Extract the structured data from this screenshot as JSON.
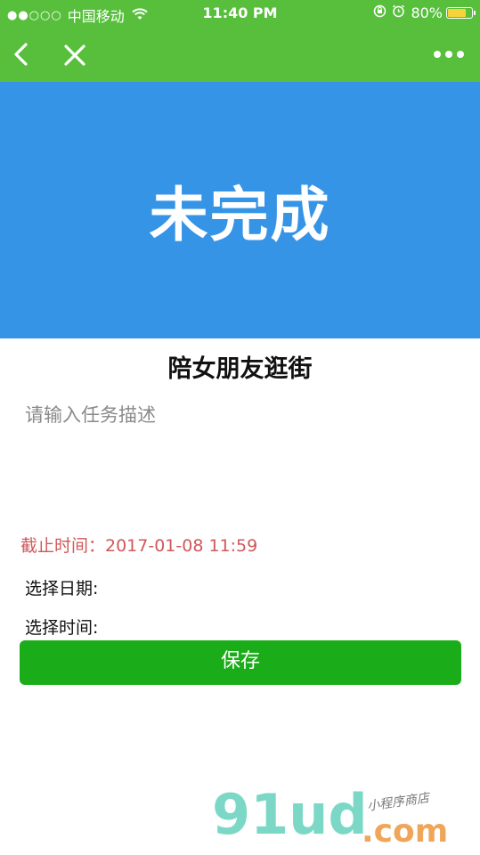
{
  "status_bar": {
    "signal": "●●○○○",
    "carrier": "中国移动",
    "time": "11:40 PM",
    "battery": "80%",
    "battery_level": 0.8
  },
  "nav": {
    "back_icon": "chevron-left-icon",
    "close_icon": "close-icon",
    "more_icon": "more-dots-icon"
  },
  "hero": {
    "status_text": "未完成",
    "background": "#3694e7"
  },
  "task": {
    "title": "陪女朋友逛街",
    "description_placeholder": "请输入任务描述",
    "description_value": ""
  },
  "deadline": {
    "label": "截止时间：2017-01-08 11:59",
    "color": "#d0585a"
  },
  "pickers": {
    "date_label": "选择日期:",
    "time_label": "选择时间:"
  },
  "actions": {
    "save_label": "保存",
    "save_color": "#1aad19"
  },
  "watermark": {
    "main": "91ud",
    "tld": ".com",
    "sub": "小程序商店"
  },
  "colors": {
    "nav_green": "#57bf3c",
    "hero_blue": "#3694e7"
  }
}
